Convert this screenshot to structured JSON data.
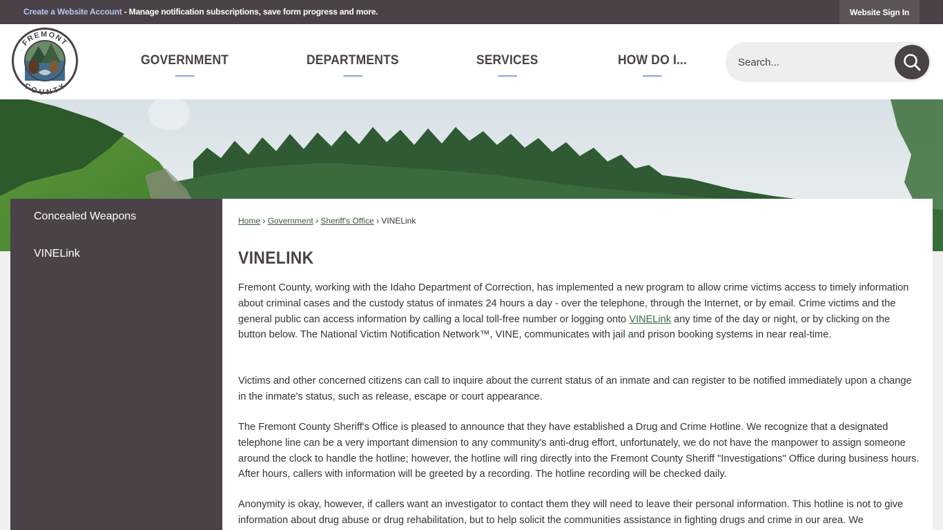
{
  "topbar": {
    "account_link": "Create a Website Account",
    "account_message": " - Manage notification subscriptions, save form progress and more.",
    "signin_label": "Website Sign In"
  },
  "header": {
    "logo_alt": "Fremont County",
    "logo_text_top": "FREMONT",
    "logo_text_bottom": "COUNTY",
    "nav": [
      {
        "label": "GOVERNMENT"
      },
      {
        "label": "DEPARTMENTS"
      },
      {
        "label": "SERVICES"
      },
      {
        "label": "HOW DO I..."
      }
    ],
    "search": {
      "placeholder": "Search...",
      "icon": "search-icon"
    }
  },
  "sidebar": {
    "items": [
      {
        "label": "Concealed Weapons"
      },
      {
        "label": "VINELink"
      }
    ]
  },
  "main": {
    "breadcrumb": [
      {
        "label": "Home"
      },
      {
        "label": "Government"
      },
      {
        "label": "Sheriff's Office"
      },
      {
        "label": "VINELink"
      }
    ],
    "breadcrumb_separator": "›",
    "title": "VINELINK",
    "paragraphs": {
      "p1_before": "Fremont County, working with the Idaho Department of Correction, has implemented a new program to allow crime victims access to timely information about criminal cases and the custody status of inmates 24 hours a day - over the telephone, through the Internet, or by email. Crime victims and the general public can access information by calling a local toll-free number or logging onto ",
      "p1_link": "VINELink",
      "p1_after": " any time of the day or night, or by clicking on the button below. The National Victim Notification Network™, VINE, communicates with jail and prison booking systems in near real-time.",
      "p2": "Victims and other concerned citizens can call to inquire about the current status of an inmate and can register to be notified immediately upon a change in the inmate's status, such as release, escape or court appearance.",
      "p3": "The Fremont County Sheriff's Office is pleased to announce that they have established a Drug and Crime Hotline. We recognize that a designated telephone line can be a very important dimension to any community's anti-drug effort, unfortunately, we do not have the manpower to assign someone around the clock to handle the hotline; however, the hotline will ring directly into the Fremont County Sheriff \"Investigations\" Office during business hours. After hours, callers with information will be greeted by a recording. The hotline recording will be checked daily.",
      "p4": "Anonymity is okay, however, if callers want an investigator to contact them they will need to leave their personal information. This hotline is not to give information about drug abuse or drug rehabilitation, but to help solicit the communities assistance in fighting drugs and crime in our area. We"
    }
  },
  "colors": {
    "primary_dark": "#4a4248",
    "accent_blue": "#8aa3d6",
    "link_green": "#3d6b45"
  }
}
